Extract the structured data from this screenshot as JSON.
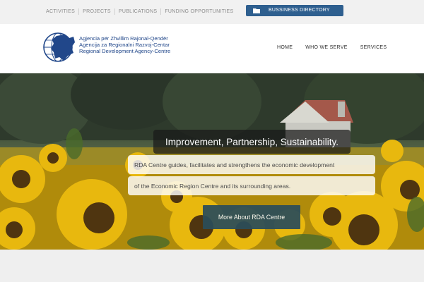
{
  "topbar": {
    "links": [
      "ACTIVITIES",
      "PROJECTS",
      "PUBLICATIONS",
      "FUNDING OPPORTUNITIES"
    ],
    "directory_button": "BUSSINESS DIRECTORY",
    "directory_icon": "folder-icon",
    "button_color": "#2e5f8f"
  },
  "header": {
    "logo_lines": [
      "Agjencia për Zhvillim Rajonal-Qendër",
      "Agencija za Regionalni Razvoj-Centar",
      "Regional Development Agency-Centre"
    ],
    "logo_color": "#21478a",
    "nav": [
      "HOME",
      "WHO WE SERVE",
      "SERVICES"
    ]
  },
  "hero": {
    "tagline": "Improvement, Partnership, Sustainability.",
    "description_line1": "RDA Centre guides, facilitates and strengthens the economic development",
    "description_line2": "of the Economic Region Centre and its surrounding areas.",
    "button": "More About RDA Centre",
    "button_color": "#2b4d5a"
  }
}
